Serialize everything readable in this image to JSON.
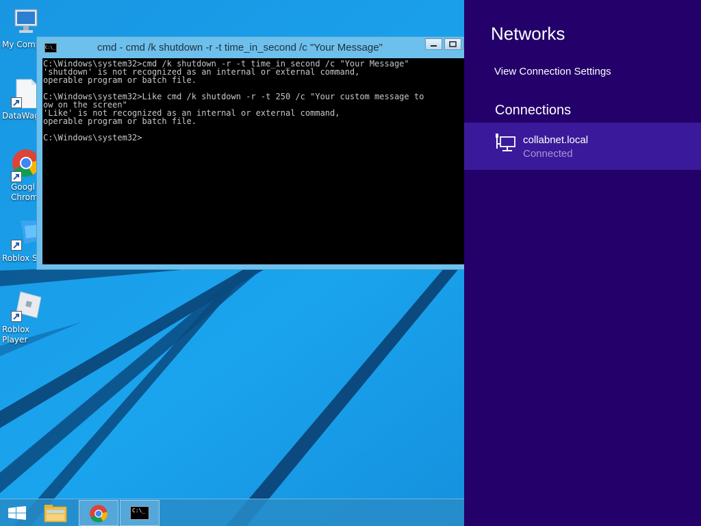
{
  "desktop": {
    "icons": [
      {
        "label": "My Comp",
        "icon": "computer-icon"
      },
      {
        "label": "DataWag",
        "icon": "document-icon"
      },
      {
        "label": "Googl Chrom",
        "icon": "chrome-icon"
      },
      {
        "label": "Roblox St",
        "icon": "roblox-studio-icon"
      },
      {
        "label": "Roblox Player",
        "icon": "roblox-player-icon"
      }
    ]
  },
  "cmd_window": {
    "title": "cmd - cmd  /k shutdown -r -t time_in_second /c \"Your Message\"",
    "icon_text": "C:\\_",
    "output": "C:\\Windows\\system32>cmd /k shutdown -r -t time_in_second /c \"Your Message\"\n'shutdown' is not recognized as an internal or external command,\noperable program or batch file.\n\nC:\\Windows\\system32>Like cmd /k shutdown -r -t 250 /c \"Your custom message to\now on the screen\"\n'Like' is not recognized as an internal or external command,\noperable program or batch file.\n\nC:\\Windows\\system32>"
  },
  "taskbar": {
    "items": [
      {
        "name": "start",
        "icon": "windows-logo-icon"
      },
      {
        "name": "file-explorer",
        "icon": "folder-icon"
      },
      {
        "name": "chrome",
        "icon": "chrome-icon"
      },
      {
        "name": "command-prompt",
        "icon": "cmd-icon",
        "icon_text": "C:\\_"
      }
    ]
  },
  "network_panel": {
    "title": "Networks",
    "view_settings": "View Connection Settings",
    "connections_heading": "Connections",
    "connection": {
      "name": "collabnet.local",
      "status": "Connected",
      "icon": "wired-network-icon"
    }
  },
  "colors": {
    "panel_bg": "#23006a",
    "panel_selected": "#3a1a9a",
    "desktop_bg": "#1b8fdc",
    "console_bg": "#000000",
    "console_text": "#c8c8c8"
  }
}
